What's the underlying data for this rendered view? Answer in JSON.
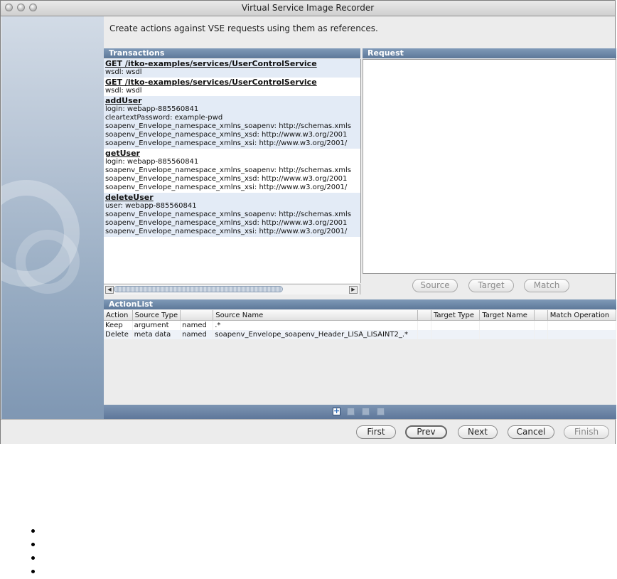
{
  "window": {
    "title": "Virtual Service Image Recorder",
    "instruction": "Create actions against VSE requests using them as references."
  },
  "transactions": {
    "header": "Transactions",
    "groups": [
      {
        "title": "GET /itko-examples/services/UserControlService",
        "lines": [
          "wsdl: wsdl"
        ]
      },
      {
        "title": "GET /itko-examples/services/UserControlService",
        "lines": [
          "wsdl: wsdl"
        ]
      },
      {
        "title": "addUser",
        "lines": [
          "login: webapp-885560841",
          "cleartextPassword: example-pwd",
          "soapenv_Envelope_namespace_xmlns_soapenv: http://schemas.xmls",
          "soapenv_Envelope_namespace_xmlns_xsd: http://www.w3.org/2001",
          "soapenv_Envelope_namespace_xmlns_xsi: http://www.w3.org/2001/"
        ]
      },
      {
        "title": "getUser",
        "lines": [
          "login: webapp-885560841",
          "soapenv_Envelope_namespace_xmlns_soapenv: http://schemas.xmls",
          "soapenv_Envelope_namespace_xmlns_xsd: http://www.w3.org/2001",
          "soapenv_Envelope_namespace_xmlns_xsi: http://www.w3.org/2001/"
        ]
      },
      {
        "title": "deleteUser",
        "lines": [
          "user: webapp-885560841",
          "soapenv_Envelope_namespace_xmlns_soapenv: http://schemas.xmls",
          "soapenv_Envelope_namespace_xmlns_xsd: http://www.w3.org/2001",
          "soapenv_Envelope_namespace_xmlns_xsi: http://www.w3.org/2001/"
        ]
      }
    ]
  },
  "request": {
    "header": "Request",
    "source_label": "Source",
    "target_label": "Target",
    "match_label": "Match"
  },
  "action_list": {
    "header": "ActionList",
    "columns": [
      "Action",
      "Source Type",
      "",
      "Source Name",
      "",
      "Target Type",
      "Target Name",
      "",
      "Match Operation"
    ],
    "rows": [
      [
        "Keep",
        "argument",
        "named",
        ".*",
        "",
        "",
        "",
        "",
        ""
      ],
      [
        "Delete",
        "meta data",
        "named",
        "soapenv_Envelope_soapenv_Header_LISA_LISAINT2_.*",
        "",
        "",
        "",
        "",
        ""
      ]
    ],
    "toolbar": {
      "add_icon": "plus-icon",
      "up_icon": "arrow-up-icon",
      "down_icon": "arrow-down-icon",
      "delete_icon": "delete-icon"
    }
  },
  "navigation": {
    "first_label": "First",
    "prev_label": "Prev",
    "next_label": "Next",
    "cancel_label": "Cancel",
    "finish_label": "Finish"
  },
  "bullets": [
    "",
    "",
    "",
    ""
  ]
}
